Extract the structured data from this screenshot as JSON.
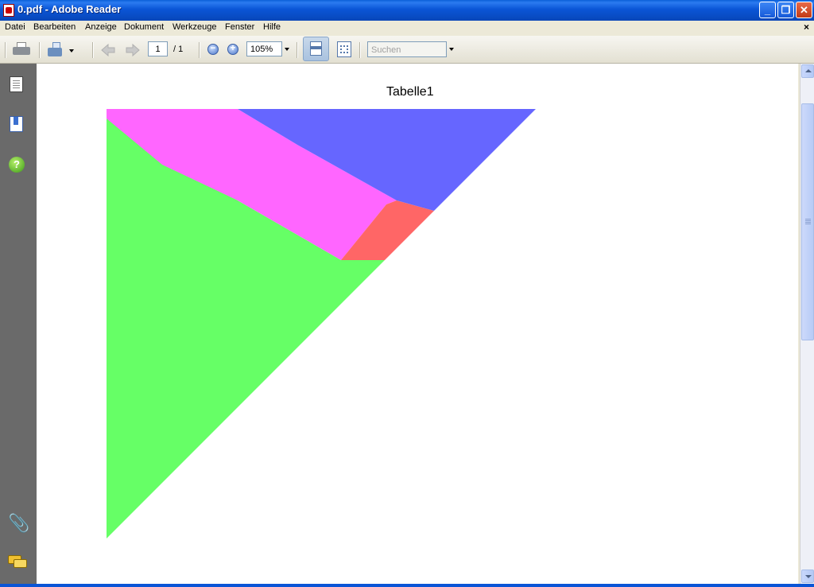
{
  "window": {
    "title": "0.pdf - Adobe Reader"
  },
  "menu": {
    "items": [
      "Datei",
      "Bearbeiten",
      "Anzeige",
      "Dokument",
      "Werkzeuge",
      "Fenster",
      "Hilfe"
    ],
    "close_glyph": "×"
  },
  "toolbar": {
    "page_current": "1",
    "page_total": "/ 1",
    "zoom": "105%",
    "search_placeholder": "Suchen",
    "zoom_out_glyph": "−",
    "zoom_in_glyph": "+"
  },
  "navpane": {
    "help_glyph": "?",
    "attachment_glyph": "📎"
  },
  "document": {
    "title": "Tabelle1",
    "regions": [
      {
        "name": "blue",
        "color": "#6666ff"
      },
      {
        "name": "magenta",
        "color": "#ff66ff"
      },
      {
        "name": "red",
        "color": "#ff6666"
      },
      {
        "name": "green",
        "color": "#66ff66"
      }
    ]
  }
}
